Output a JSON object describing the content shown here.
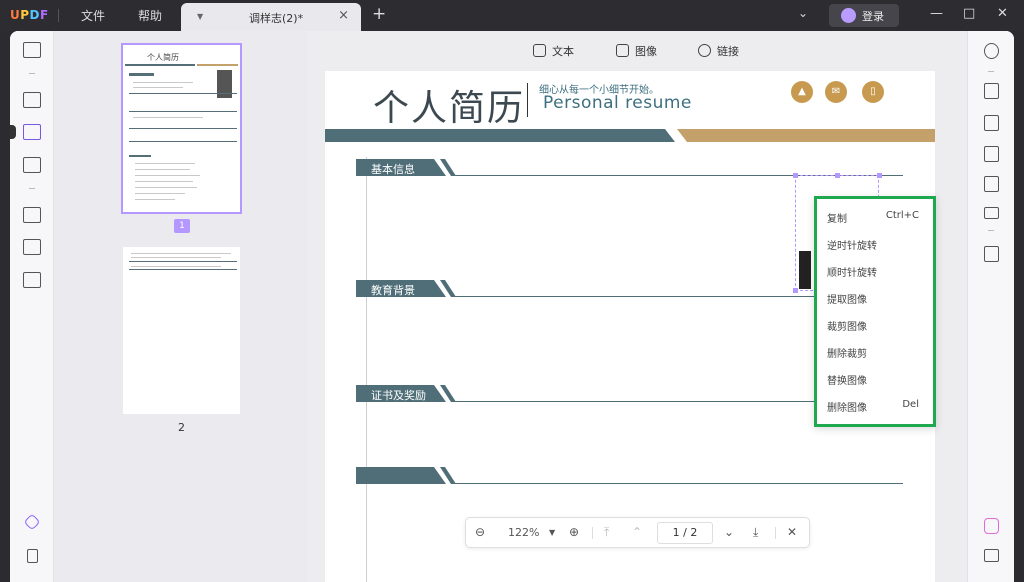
{
  "app": {
    "logo": "UPDF"
  },
  "menu": {
    "file": "文件",
    "help": "帮助"
  },
  "tab": {
    "title": "调样志(2)*",
    "close": "×",
    "new_tab": "+"
  },
  "account": {
    "login_label": "登录"
  },
  "window": {
    "minimize": "—",
    "maximize": "□",
    "close": "✕",
    "dropdown": "⌄"
  },
  "edit_toolbar": {
    "text": "文本",
    "image": "图像",
    "link": "链接"
  },
  "thumbnails": [
    {
      "page": "1",
      "selected": true
    },
    {
      "page": "2",
      "selected": false
    }
  ],
  "mini_page": {
    "title": "个人简历"
  },
  "document": {
    "title_cn": "个人简历",
    "subtitle_cn": "细心从每一个小细节开始。",
    "subtitle_en": "Personal  resume",
    "sections": [
      "基本信息",
      "教育背景",
      "证书及奖励",
      ""
    ]
  },
  "context_menu": {
    "items": [
      {
        "label": "复制",
        "shortcut": "Ctrl+C"
      },
      {
        "label": "逆时针旋转",
        "shortcut": ""
      },
      {
        "label": "顺时针旋转",
        "shortcut": ""
      },
      {
        "label": "提取图像",
        "shortcut": ""
      },
      {
        "label": "裁剪图像",
        "shortcut": ""
      },
      {
        "label": "删除裁剪",
        "shortcut": ""
      },
      {
        "label": "替换图像",
        "shortcut": ""
      },
      {
        "label": "删除图像",
        "shortcut": "Del"
      }
    ]
  },
  "zoom": {
    "level": "122%",
    "current_page": "1",
    "total_pages": "2",
    "page_display": "1 / 2"
  },
  "colors": {
    "accent": "#b497ff",
    "resume_dark": "#4f6e78",
    "resume_gold": "#c4a06a",
    "highlight": "#1fa84f"
  }
}
